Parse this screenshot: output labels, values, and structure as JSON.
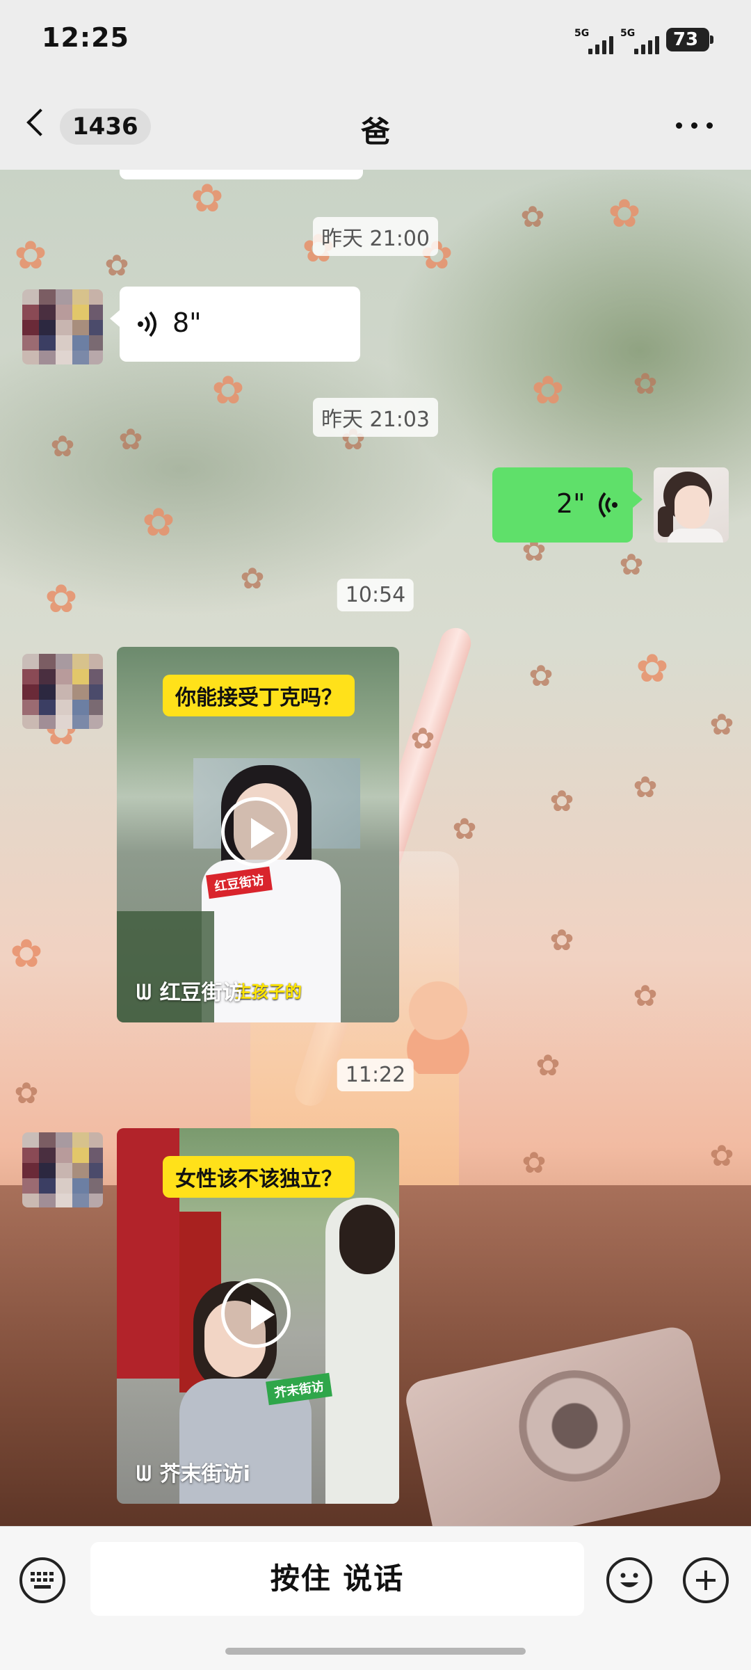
{
  "status_bar": {
    "time": "12:25",
    "signal_1_label": "5G",
    "signal_2_label": "5G",
    "battery": "73"
  },
  "header": {
    "unread_count": "1436",
    "title": "爸"
  },
  "messages": [
    {
      "type": "timestamp",
      "text": "昨天 21:00"
    },
    {
      "type": "voice",
      "direction": "in",
      "duration": "8\""
    },
    {
      "type": "timestamp",
      "text": "昨天 21:03"
    },
    {
      "type": "voice",
      "direction": "out",
      "duration": "2\""
    },
    {
      "type": "timestamp",
      "text": "10:54"
    },
    {
      "type": "video",
      "direction": "in",
      "title": "你能接受丁克吗？",
      "source": "红豆街访",
      "badge": "红豆街访",
      "caption": "生孩子的"
    },
    {
      "type": "timestamp",
      "text": "11:22"
    },
    {
      "type": "video",
      "direction": "in",
      "title": "女性该不该独立？",
      "source": "芥末街访i",
      "badge": "芥末街访"
    }
  ],
  "input_bar": {
    "voice_hold_label": "按住 说话"
  },
  "colors": {
    "outgoing_bubble": "#5fe06a",
    "title_tag": "#ffe11a"
  },
  "icons": [
    "back-chevron-icon",
    "more-icon",
    "voice-wave-icon",
    "play-icon",
    "keyboard-icon",
    "emoji-icon",
    "plus-icon"
  ]
}
